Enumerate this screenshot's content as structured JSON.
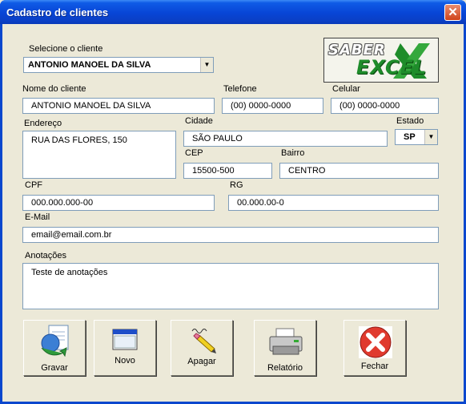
{
  "window": {
    "title": "Cadastro de clientes",
    "close_glyph": "✕"
  },
  "client_select": {
    "label": "Selecione o cliente",
    "value": "ANTONIO MANOEL DA SILVA"
  },
  "logo": {
    "line1": "SABER",
    "line2": "EXCEL"
  },
  "fields": {
    "nome": {
      "label": "Nome do cliente",
      "value": "ANTONIO MANOEL DA SILVA"
    },
    "telefone": {
      "label": "Telefone",
      "value": "(00) 0000-0000"
    },
    "celular": {
      "label": "Celular",
      "value": "(00) 0000-0000"
    },
    "endereco": {
      "label": "Endereço",
      "value": "RUA DAS FLORES, 150"
    },
    "cidade": {
      "label": "Cidade",
      "value": "SÃO PAULO"
    },
    "estado": {
      "label": "Estado",
      "value": "SP"
    },
    "cep": {
      "label": "CEP",
      "value": "15500-500"
    },
    "bairro": {
      "label": "Bairro",
      "value": "CENTRO"
    },
    "cpf": {
      "label": "CPF",
      "value": "000.000.000-00"
    },
    "rg": {
      "label": "RG",
      "value": "00.000.00-0"
    },
    "email": {
      "label": "E-Mail",
      "value": "email@email.com.br"
    },
    "anotacoes": {
      "label": "Anotações",
      "value": "Teste de anotações"
    }
  },
  "buttons": {
    "gravar": "Gravar",
    "novo": "Novo",
    "apagar": "Apagar",
    "relatorio": "Relatório",
    "fechar": "Fechar"
  },
  "colors": {
    "titlebar": "#0A47CE",
    "face": "#ECE9D8",
    "field_border": "#7F9DB9",
    "logo_green": "#1E8C2A"
  }
}
